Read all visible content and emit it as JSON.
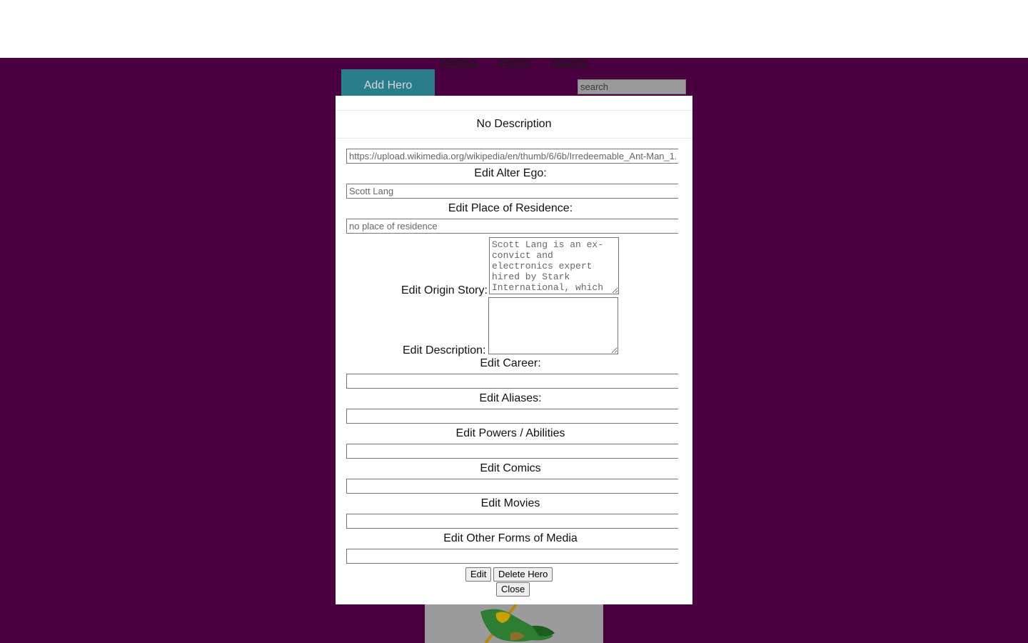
{
  "nav": {
    "heroes": "Heroes",
    "home": "Home",
    "villains": "Villains"
  },
  "toolbar": {
    "add_hero_label": "Add Hero",
    "search_placeholder": "search"
  },
  "modal": {
    "title": "No Description",
    "image_url": "https://upload.wikimedia.org/wikipedia/en/thumb/6/6b/Irredeemable_Ant-Man_1.jpg",
    "alter_ego_label": "Edit Alter Ego:",
    "alter_ego_value": "Scott Lang",
    "residence_label": "Edit Place of Residence:",
    "residence_value": "no place of residence",
    "origin_label": "Edit Origin Story:",
    "origin_value": "Scott Lang is an ex-convict and electronics expert hired by Stark International, which",
    "description_label": "Edit Description:",
    "description_value": "",
    "career_label": "Edit Career:",
    "career_value": "",
    "aliases_label": "Edit Aliases:",
    "aliases_value": "",
    "powers_label": "Edit Powers / Abilities",
    "powers_value": "",
    "comics_label": "Edit Comics",
    "comics_value": "",
    "movies_label": "Edit Movies",
    "movies_value": "",
    "media_label": "Edit Other Forms of Media",
    "media_value": "",
    "edit_button": "Edit",
    "delete_button": "Delete Hero",
    "close_button": "Close"
  },
  "colors": {
    "page_background": "#4a003f",
    "add_hero_button": "#2a7d8b"
  },
  "icons": {
    "hero_card": "hero-figure-icon"
  }
}
